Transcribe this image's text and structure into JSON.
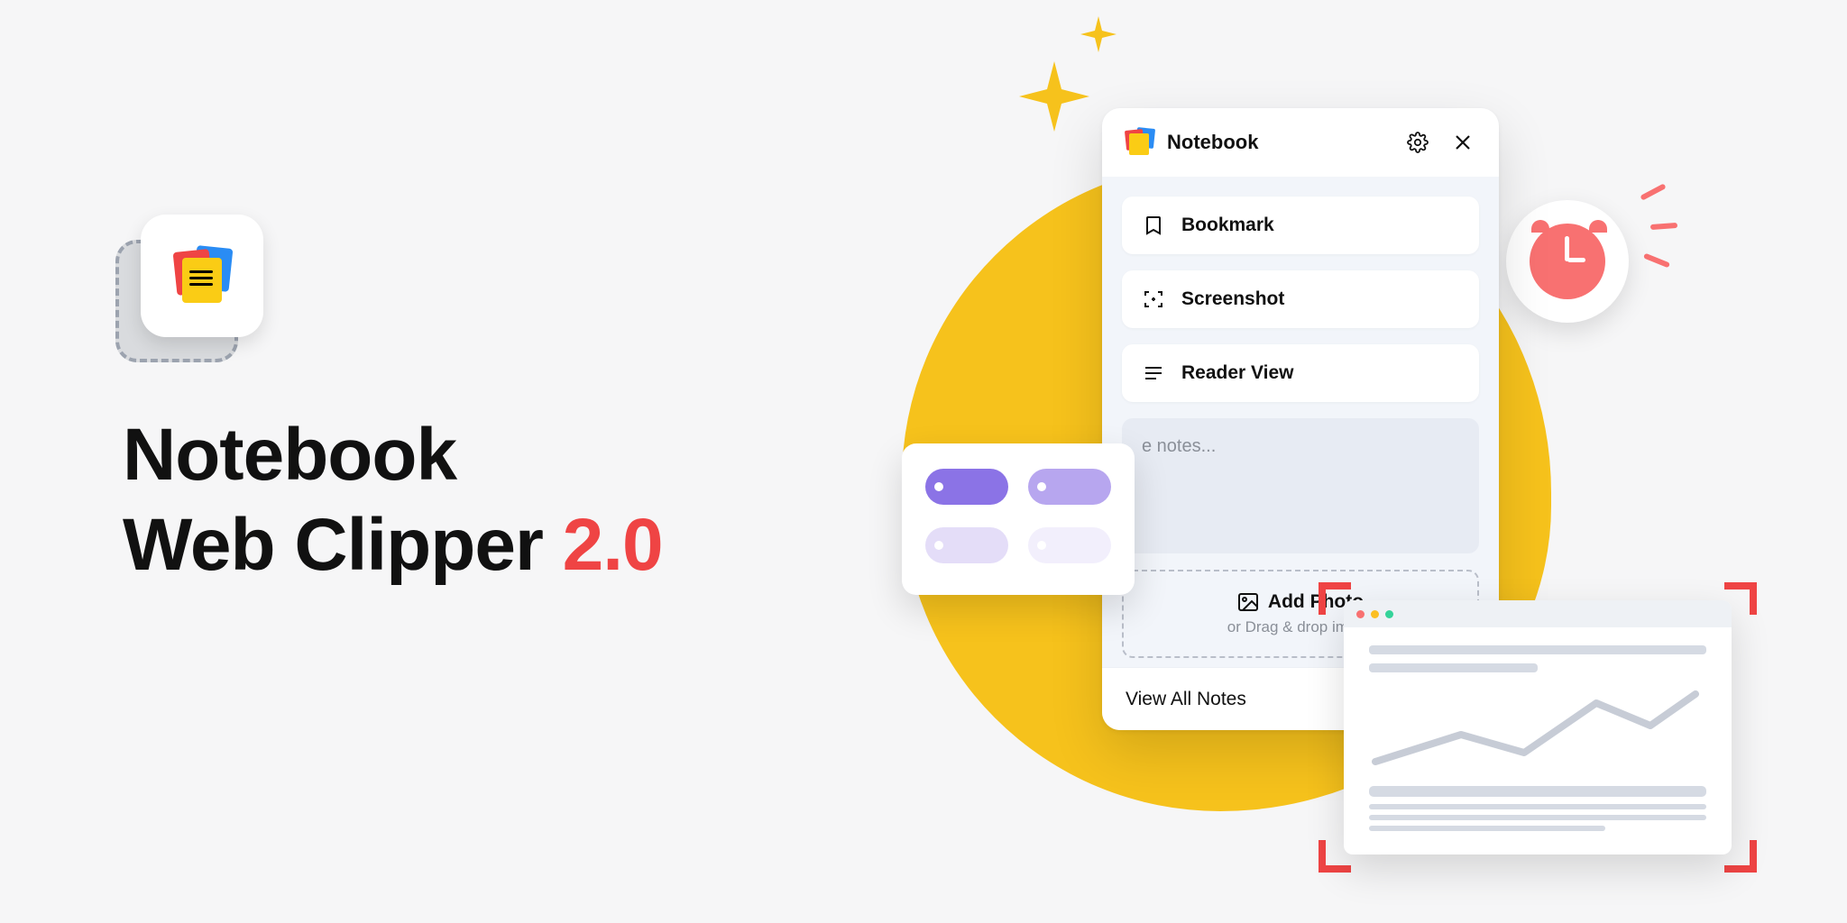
{
  "hero": {
    "line1": "Notebook",
    "line2_prefix": "Web Clipper ",
    "line2_accent": "2.0"
  },
  "panel": {
    "title": "Notebook",
    "options": {
      "bookmark": "Bookmark",
      "screenshot": "Screenshot",
      "reader": "Reader View"
    },
    "notes_placeholder": "e notes...",
    "add_photo": "Add Photo",
    "drag_hint": "or Drag & drop image",
    "footer_link": "View All Notes"
  },
  "colors": {
    "accent_red": "#ef4444",
    "yellow": "#f6c21c",
    "coral": "#f87171",
    "purple": "#8b73e6"
  }
}
